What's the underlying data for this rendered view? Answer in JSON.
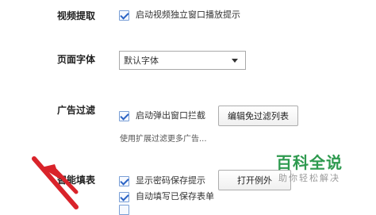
{
  "video": {
    "label": "视频提取",
    "checkbox_label": "启动视频独立窗口播放提示",
    "checked": true
  },
  "font": {
    "label": "页面字体",
    "selected": "默认字体"
  },
  "adfilter": {
    "label": "广告过滤",
    "checkbox_label": "启动弹出窗口拦截",
    "checked": true,
    "edit_button": "编辑免过滤列表",
    "hint": "使用扩展过滤更多广告..."
  },
  "autofill": {
    "label": "智能填表",
    "show_password_label": "显示密码保存提示",
    "show_password_checked": true,
    "exception_button": "打开例外",
    "autofill_saved_label": "自动填写已保存表单",
    "autofill_saved_checked": true
  },
  "watermark": {
    "title": "百科全说",
    "subtitle": "助你轻松解决"
  },
  "colors": {
    "accent": "#2b63c4",
    "watermark_green": "#2e9a4f",
    "arrow_red": "#d9232a"
  }
}
